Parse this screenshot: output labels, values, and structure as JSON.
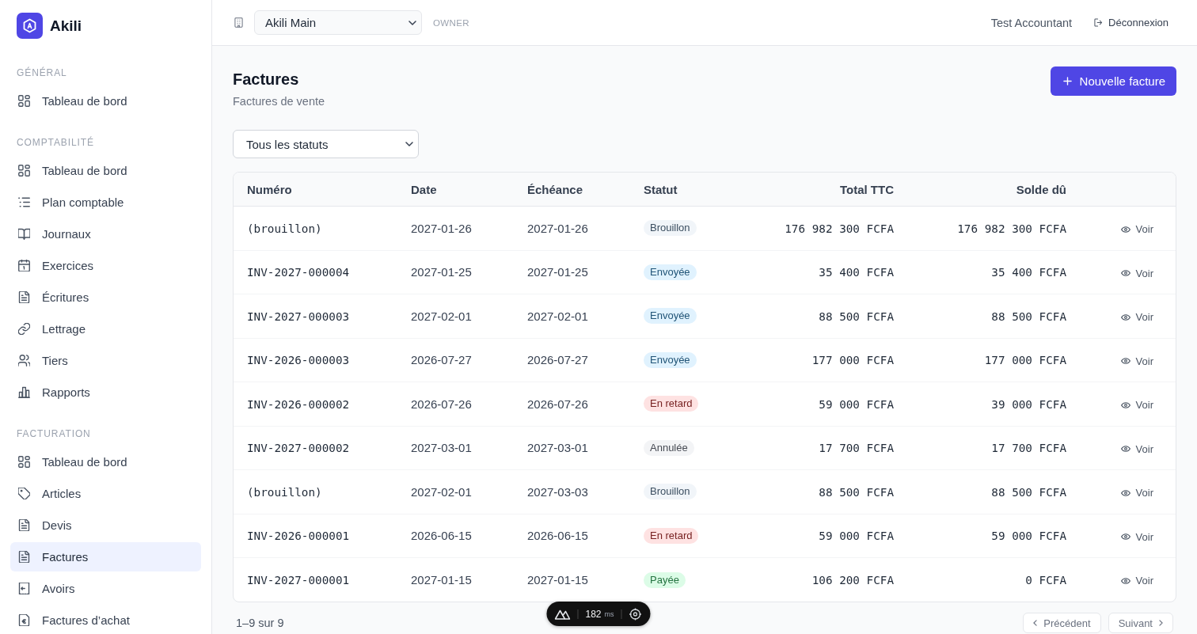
{
  "sidebar": {
    "brand": "Akili",
    "sections": [
      {
        "title": "GÉNÉRAL",
        "items": [
          {
            "label": "Tableau de bord",
            "kind": "dashboard",
            "selected": false
          }
        ]
      },
      {
        "title": "COMPTABILITÉ",
        "items": [
          {
            "label": "Tableau de bord",
            "kind": "dashboard",
            "selected": false
          },
          {
            "label": "Plan comptable",
            "kind": "accounts",
            "selected": false
          },
          {
            "label": "Journaux",
            "kind": "journals",
            "selected": false
          },
          {
            "label": "Exercices",
            "kind": "periods",
            "selected": false
          },
          {
            "label": "Écritures",
            "kind": "entries",
            "selected": false
          },
          {
            "label": "Lettrage",
            "kind": "matching",
            "selected": false
          },
          {
            "label": "Tiers",
            "kind": "contacts",
            "selected": false
          },
          {
            "label": "Rapports",
            "kind": "reports",
            "selected": false
          }
        ]
      },
      {
        "title": "FACTURATION",
        "items": [
          {
            "label": "Tableau de bord",
            "kind": "dashboard",
            "selected": false
          },
          {
            "label": "Articles",
            "kind": "products",
            "selected": false
          },
          {
            "label": "Devis",
            "kind": "quotes",
            "selected": false
          },
          {
            "label": "Factures",
            "kind": "invoices",
            "selected": true
          },
          {
            "label": "Avoirs",
            "kind": "credits",
            "selected": false
          },
          {
            "label": "Factures d’achat",
            "kind": "purchases",
            "selected": false
          }
        ]
      }
    ]
  },
  "header": {
    "organization_select": {
      "value": "Akili Main"
    },
    "role": "OWNER",
    "user_name": "Test Accountant",
    "logout_button": "Déconnexion"
  },
  "page": {
    "title": "Factures",
    "subtitle": "Factures de vente",
    "new_invoice_button": "Nouvelle facture",
    "status_filter": {
      "value": "Tous les statuts"
    }
  },
  "table": {
    "columns": [
      {
        "label": "Numéro",
        "kind": "text"
      },
      {
        "label": "Date",
        "kind": "date"
      },
      {
        "label": "Échéance",
        "kind": "date"
      },
      {
        "label": "Statut",
        "kind": "status"
      },
      {
        "label": "Total TTC",
        "kind": "amount"
      },
      {
        "label": "Solde dû",
        "kind": "amount"
      }
    ],
    "rows": [
      {
        "number": "(brouillon)",
        "date": "2027-01-26",
        "due_date": "2027-01-26",
        "status": {
          "label": "Brouillon",
          "color": "#f1f5f9"
        },
        "total": "176 982 300 FCFA",
        "balance": "176 982 300 FCFA",
        "action": "Voir"
      },
      {
        "number": "INV-2027-000004",
        "date": "2027-01-25",
        "due_date": "2027-01-25",
        "status": {
          "label": "Envoyée",
          "color": "#e0f2fe"
        },
        "total": "35 400 FCFA",
        "balance": "35 400 FCFA",
        "action": "Voir"
      },
      {
        "number": "INV-2027-000003",
        "date": "2027-02-01",
        "due_date": "2027-02-01",
        "status": {
          "label": "Envoyée",
          "color": "#e0f2fe"
        },
        "total": "88 500 FCFA",
        "balance": "88 500 FCFA",
        "action": "Voir"
      },
      {
        "number": "INV-2026-000003",
        "date": "2026-07-27",
        "due_date": "2026-07-27",
        "status": {
          "label": "Envoyée",
          "color": "#e0f2fe"
        },
        "total": "177 000 FCFA",
        "balance": "177 000 FCFA",
        "action": "Voir"
      },
      {
        "number": "INV-2026-000002",
        "date": "2026-07-26",
        "due_date": "2026-07-26",
        "status": {
          "label": "En retard",
          "color": "#fee2e2"
        },
        "total": "59 000 FCFA",
        "balance": "39 000 FCFA",
        "action": "Voir"
      },
      {
        "number": "INV-2027-000002",
        "date": "2027-03-01",
        "due_date": "2027-03-01",
        "status": {
          "label": "Annulée",
          "color": "#f3f4f6"
        },
        "total": "17 700 FCFA",
        "balance": "17 700 FCFA",
        "action": "Voir"
      },
      {
        "number": "(brouillon)",
        "date": "2027-02-01",
        "due_date": "2027-03-03",
        "status": {
          "label": "Brouillon",
          "color": "#f1f5f9"
        },
        "total": "88 500 FCFA",
        "balance": "88 500 FCFA",
        "action": "Voir"
      },
      {
        "number": "INV-2026-000001",
        "date": "2026-06-15",
        "due_date": "2026-06-15",
        "status": {
          "label": "En retard",
          "color": "#fee2e2"
        },
        "total": "59 000 FCFA",
        "balance": "59 000 FCFA",
        "action": "Voir"
      },
      {
        "number": "INV-2027-000001",
        "date": "2027-01-15",
        "due_date": "2027-01-15",
        "status": {
          "label": "Payée",
          "color": "#dcfce7"
        },
        "total": "106 200 FCFA",
        "balance": "0 FCFA",
        "action": "Voir"
      }
    ]
  },
  "pagination": {
    "summary": "1–9 sur 9",
    "buttons": [
      {
        "label": "Précédent",
        "kind": "previous",
        "disabled": true
      },
      {
        "label": "Suivant",
        "kind": "next",
        "disabled": true
      }
    ]
  },
  "devtools": {
    "duration": "182",
    "unit": "ms"
  }
}
